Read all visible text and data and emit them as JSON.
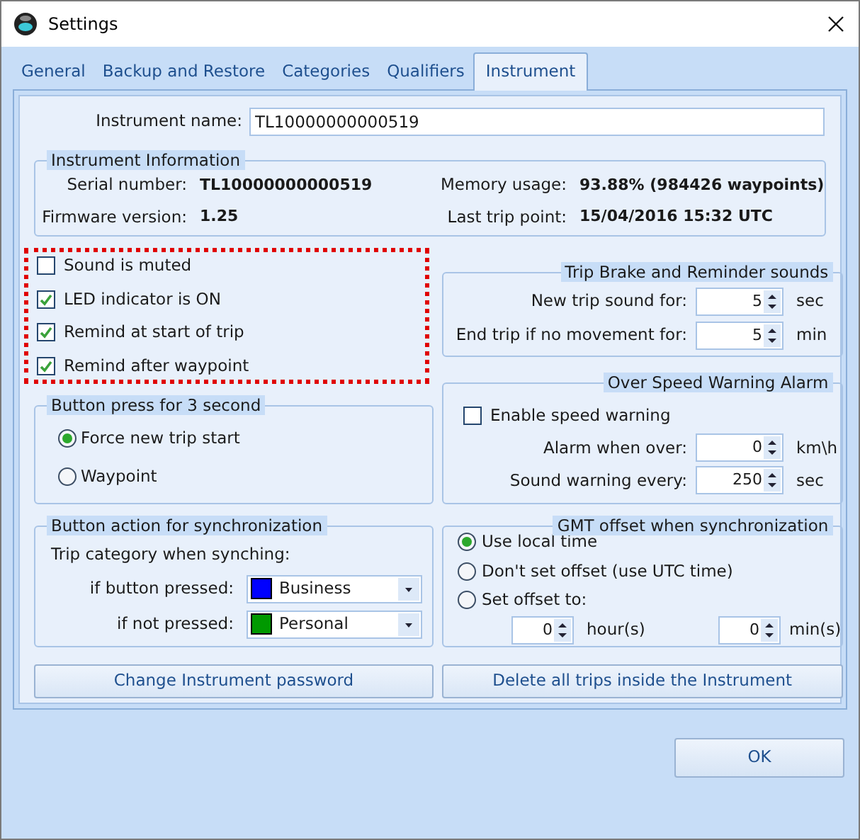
{
  "window": {
    "title": "Settings"
  },
  "tabs": [
    {
      "label": "General",
      "selected": false
    },
    {
      "label": "Backup and Restore",
      "selected": false
    },
    {
      "label": "Categories",
      "selected": false
    },
    {
      "label": "Qualifiers",
      "selected": false
    },
    {
      "label": "Instrument",
      "selected": true
    }
  ],
  "instrument_name": {
    "label": "Instrument name:",
    "value": "TL10000000000519"
  },
  "instrument_information": {
    "title": "Instrument Information",
    "fields": [
      {
        "label": "Serial number:",
        "value": "TL10000000000519"
      },
      {
        "label": "Memory usage:",
        "value": "93.88% (984426 waypoints)"
      },
      {
        "label": "Firmware version:",
        "value": "1.25"
      },
      {
        "label": "Last trip point:",
        "value": "15/04/2016 15:32 UTC"
      }
    ]
  },
  "options": [
    {
      "label": "Sound is muted",
      "checked": false
    },
    {
      "label": "LED indicator is ON",
      "checked": true
    },
    {
      "label": "Remind at start of trip",
      "checked": true
    },
    {
      "label": "Remind after waypoint",
      "checked": true
    }
  ],
  "trip_brake": {
    "title": "Trip Brake and Reminder sounds",
    "rows": [
      {
        "label": "New trip sound for:",
        "value": "5",
        "unit": "sec"
      },
      {
        "label": "End trip if no movement for:",
        "value": "5",
        "unit": "min"
      }
    ]
  },
  "button_press": {
    "title": "Button press for 3 second",
    "options": [
      {
        "label": "Force new trip start",
        "selected": true
      },
      {
        "label": "Waypoint",
        "selected": false
      }
    ]
  },
  "over_speed": {
    "title": "Over Speed Warning Alarm",
    "enable": {
      "label": "Enable speed warning",
      "checked": false
    },
    "rows": [
      {
        "label": "Alarm when over:",
        "value": "0",
        "unit": "km\\h"
      },
      {
        "label": "Sound warning every:",
        "value": "250",
        "unit": "sec"
      }
    ]
  },
  "button_action": {
    "title": "Button action for synchronization",
    "caption": "Trip category when synching:",
    "rows": [
      {
        "label": "if button pressed:",
        "value": "Business",
        "color": "#0000ff"
      },
      {
        "label": "if not pressed:",
        "value": "Personal",
        "color": "#009900"
      }
    ]
  },
  "gmt_offset": {
    "title": "GMT offset when synchronization",
    "options": [
      {
        "label": "Use local time",
        "selected": true
      },
      {
        "label": "Don't set offset (use UTC time)",
        "selected": false
      },
      {
        "label": "Set offset to:",
        "selected": false
      }
    ],
    "hours": {
      "value": "0",
      "unit": "hour(s)"
    },
    "minutes": {
      "value": "0",
      "unit": "min(s)"
    }
  },
  "action_buttons": [
    {
      "label": "Change Instrument password"
    },
    {
      "label": "Delete all trips inside the Instrument"
    }
  ],
  "ok_button": {
    "label": "OK"
  }
}
